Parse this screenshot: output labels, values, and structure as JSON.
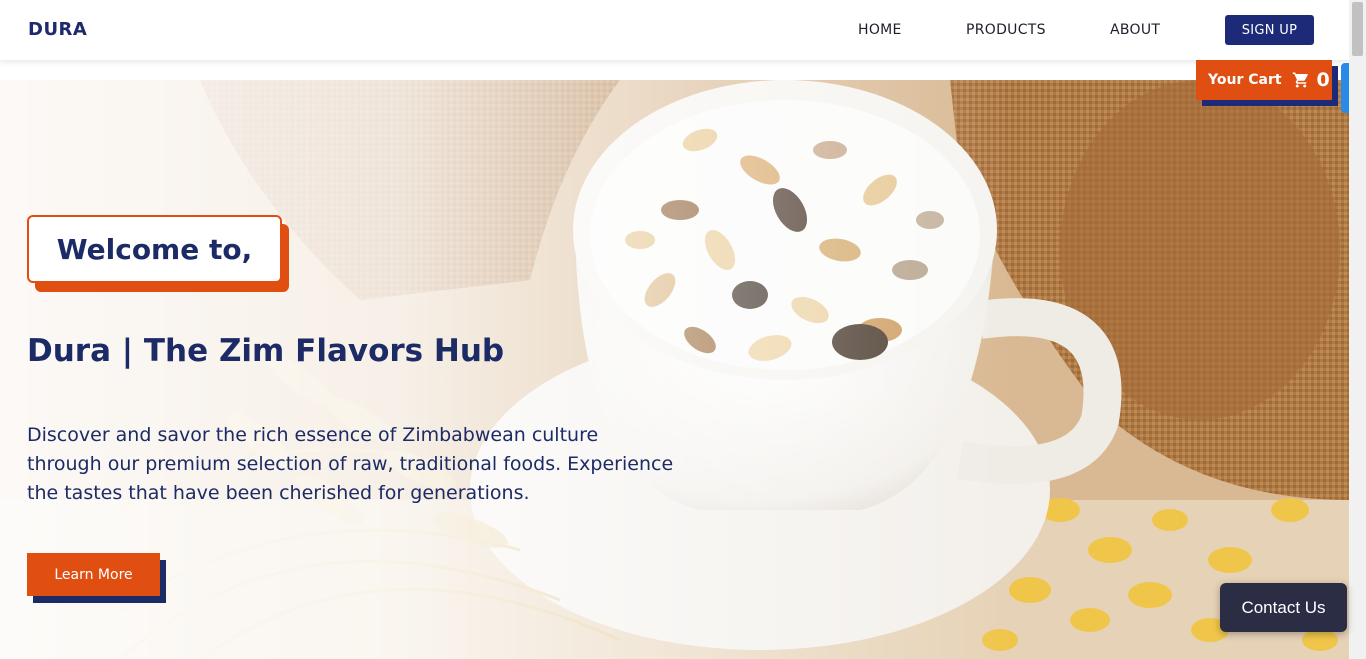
{
  "navbar": {
    "brand": "DURA",
    "links": [
      "HOME",
      "PRODUCTS",
      "ABOUT"
    ],
    "signup_label": "SIGN UP"
  },
  "cart": {
    "label": "Your Cart",
    "count": "0",
    "icon": "shopping-cart-icon"
  },
  "hero": {
    "welcome": "Welcome to,",
    "title": "Dura | The Zim Flavors Hub",
    "description": "Discover and savor the rich essence of Zimbabwean culture through our premium selection of raw, traditional foods. Experience the tastes that have been cherished for generations.",
    "learn_more_label": "Learn More",
    "background_image": "cup of yogurt with granola and nuts, wheat stalks, burlap sacks"
  },
  "contact": {
    "label": "Contact Us"
  },
  "colors": {
    "navy": "#1c2a66",
    "accent_orange": "#e04e12",
    "contact_bg": "#2a2d44"
  }
}
